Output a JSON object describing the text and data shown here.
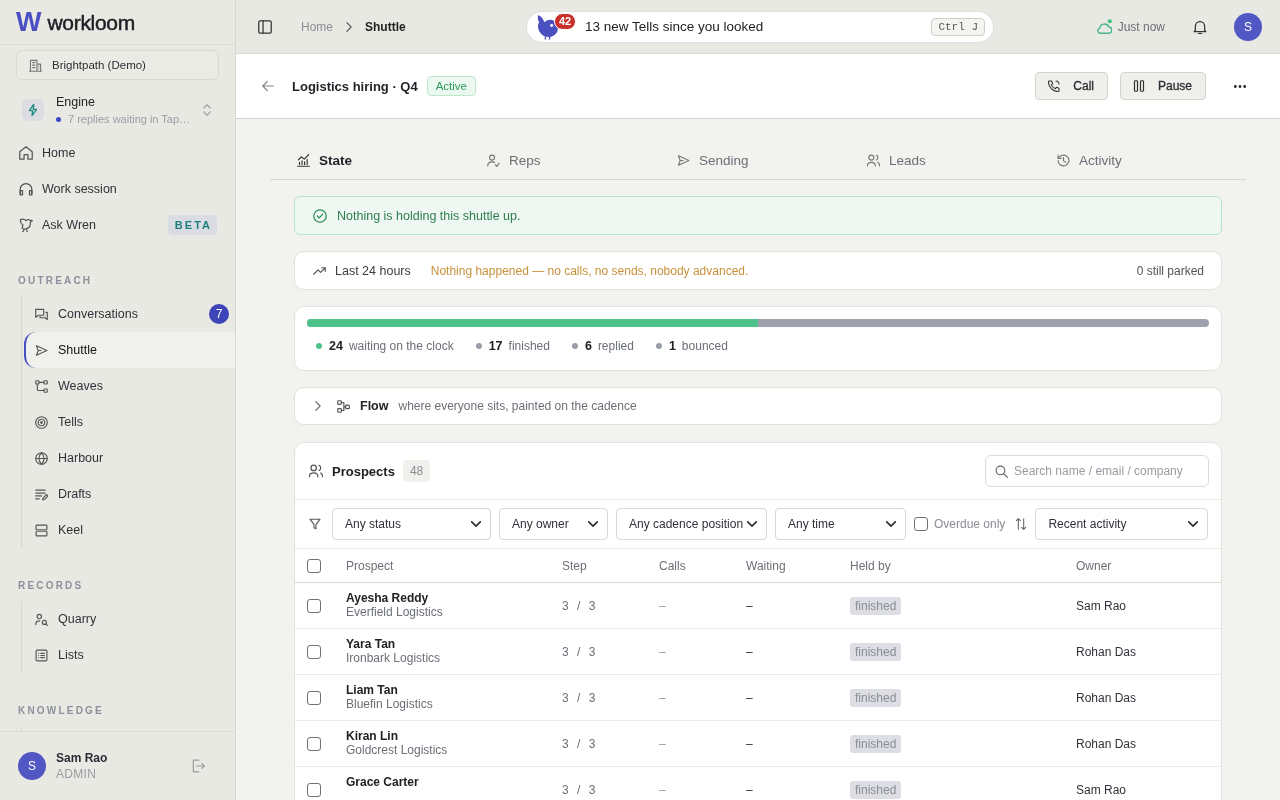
{
  "sidebar": {
    "logo": {
      "mark": "W",
      "wordmark": "workloom"
    },
    "workspace": "Brightpath (Demo)",
    "engine": {
      "title": "Engine",
      "status": "7 replies waiting in Tap…"
    },
    "nav": [
      {
        "label": "Home",
        "selected": false
      },
      {
        "label": "Work session",
        "selected": false
      },
      {
        "label": "Ask Wren",
        "badge": "BETA",
        "selected": false
      }
    ],
    "sections": [
      {
        "title": "OUTREACH",
        "items": [
          {
            "label": "Conversations",
            "count": "7",
            "selected": false
          },
          {
            "label": "Shuttle",
            "selected": true
          },
          {
            "label": "Weaves",
            "selected": false
          },
          {
            "label": "Tells",
            "selected": false
          },
          {
            "label": "Harbour",
            "selected": false
          },
          {
            "label": "Drafts",
            "selected": false
          },
          {
            "label": "Keel",
            "selected": false
          }
        ]
      },
      {
        "title": "RECORDS",
        "items": [
          {
            "label": "Quarry",
            "selected": false
          },
          {
            "label": "Lists",
            "selected": false
          }
        ]
      },
      {
        "title": "KNOWLEDGE"
      }
    ],
    "user": {
      "avatar": "S",
      "name": "Sam Rao",
      "role": "ADMIN"
    }
  },
  "topbar": {
    "breadcrumb": [
      {
        "label": "Home",
        "current": false
      },
      {
        "label": "Shuttle",
        "current": true
      }
    ],
    "notice": {
      "badge": "42",
      "text": "13 new Tells since you looked",
      "shortcut": "Ctrl J"
    },
    "sync": "Just now",
    "avatar": "S"
  },
  "header": {
    "title": "Logistics hiring · Q4",
    "status": "Active",
    "actions": [
      "Call",
      "Pause"
    ]
  },
  "tabs": [
    {
      "label": "State",
      "selected": true
    },
    {
      "label": "Reps",
      "selected": false
    },
    {
      "label": "Sending",
      "selected": false
    },
    {
      "label": "Leads",
      "selected": false
    },
    {
      "label": "Activity",
      "selected": false
    }
  ],
  "health": {
    "text": "Nothing is holding this shuttle up."
  },
  "recent": {
    "label": "Last 24 hours",
    "summary": "Nothing happened — no calls, no sends, nobody advanced.",
    "parked": "0 still parked"
  },
  "progress": {
    "level": 0.5,
    "legend": [
      {
        "count": "24",
        "label": "waiting on the clock",
        "color": "#4cc38a"
      },
      {
        "count": "17",
        "label": "finished",
        "color": "#9a9ea8"
      },
      {
        "count": "6",
        "label": "replied",
        "color": "#9a9ea8"
      },
      {
        "count": "1",
        "label": "bounced",
        "color": "#9a9ea8"
      }
    ]
  },
  "flow": {
    "expanded": false,
    "title": "Flow",
    "subtitle": "where everyone sits, painted on the cadence"
  },
  "prospects": {
    "title": "Prospects",
    "count": "48",
    "search_placeholder": "Search name / email / company",
    "filters": [
      "Any status",
      "Any owner",
      "Any cadence position",
      "Any time"
    ],
    "overdue": {
      "label": "Overdue only",
      "checked": false
    },
    "sort": "Recent activity",
    "all_selected": false,
    "columns": [
      "Prospect",
      "Step",
      "Calls",
      "Waiting",
      "Held by",
      "Owner"
    ],
    "rows": [
      {
        "name": "Ayesha Reddy",
        "company": "Everfield Logistics",
        "step": "3 / 3",
        "calls": "–",
        "waiting": "–",
        "held_by": "finished",
        "owner": "Sam Rao",
        "selected": false
      },
      {
        "name": "Yara Tan",
        "company": "Ironbark Logistics",
        "step": "3 / 3",
        "calls": "–",
        "waiting": "–",
        "held_by": "finished",
        "owner": "Rohan Das",
        "selected": false
      },
      {
        "name": "Liam Tan",
        "company": "Bluefin Logistics",
        "step": "3 / 3",
        "calls": "–",
        "waiting": "–",
        "held_by": "finished",
        "owner": "Rohan Das",
        "selected": false
      },
      {
        "name": "Kiran Lin",
        "company": "Goldcrest Logistics",
        "step": "3 / 3",
        "calls": "–",
        "waiting": "–",
        "held_by": "finished",
        "owner": "Rohan Das",
        "selected": false
      },
      {
        "name": "Grace Carter",
        "step": "3 / 3",
        "calls": "–",
        "waiting": "–",
        "held_by": "finished",
        "owner": "Sam Rao",
        "selected": false
      }
    ]
  }
}
